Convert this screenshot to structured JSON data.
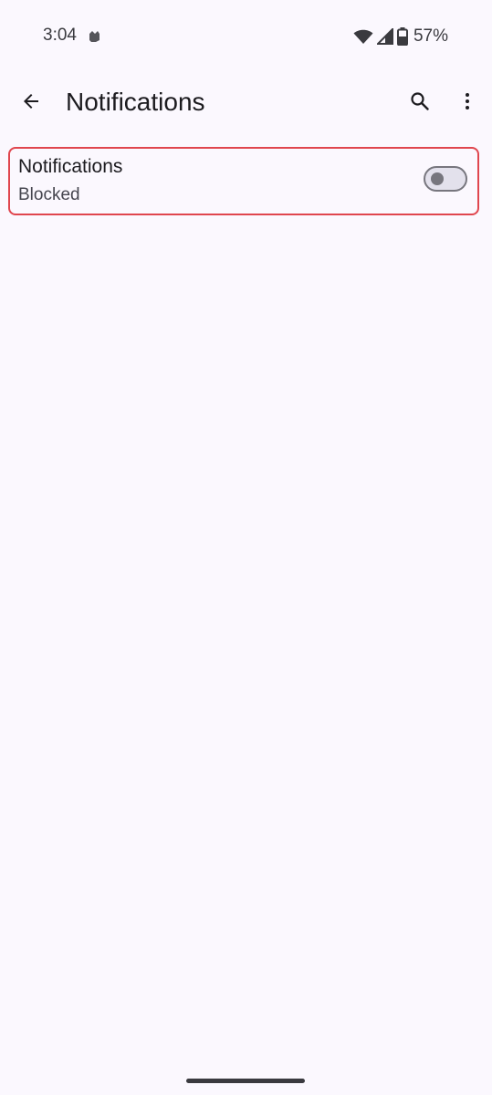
{
  "status_bar": {
    "time": "3:04",
    "battery": "57%",
    "icons": [
      "app-notification-icon",
      "wifi-icon",
      "cell-signal-icon",
      "battery-icon"
    ]
  },
  "app_bar": {
    "title": "Notifications",
    "back_icon": "arrow-back-icon",
    "search_icon": "search-icon",
    "more_icon": "more-vert-icon"
  },
  "setting": {
    "title": "Notifications",
    "summary": "Blocked",
    "toggle_on": false,
    "highlight_color": "#E0464E"
  },
  "colors": {
    "background": "#FBF8FE",
    "text_primary": "#1C1B1F",
    "text_secondary": "#46464F",
    "toggle_outline": "#77767E"
  }
}
